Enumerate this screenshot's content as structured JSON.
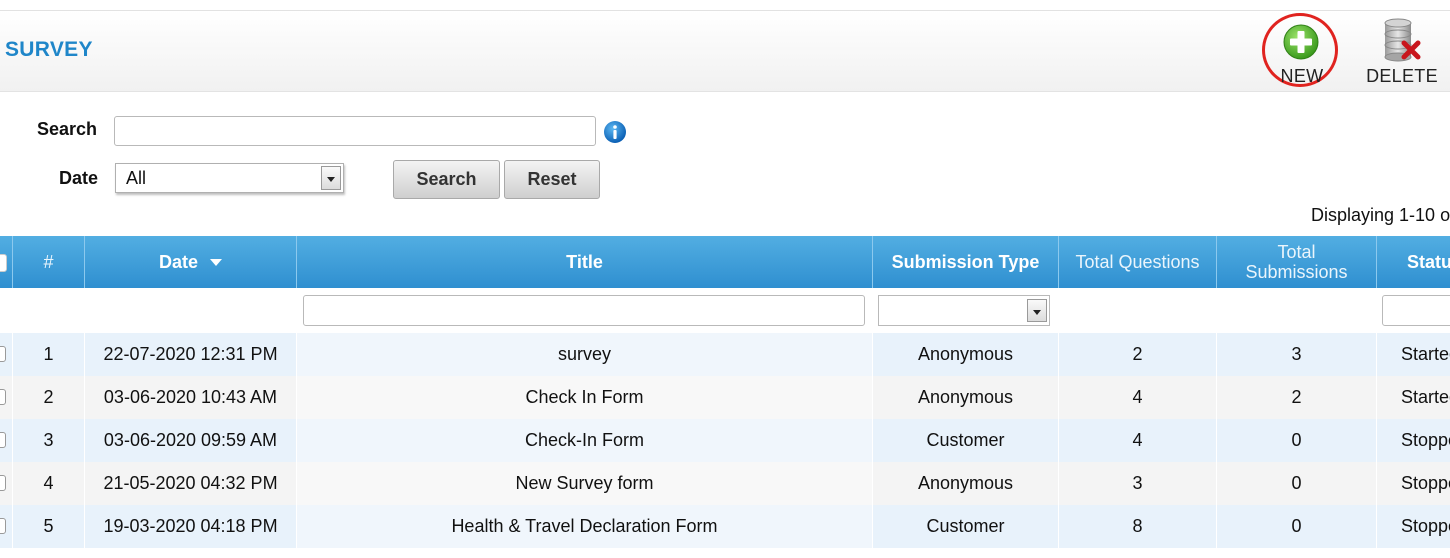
{
  "header": {
    "title": "SURVEY",
    "new_label": "NEW",
    "delete_label": "DELETE"
  },
  "filters": {
    "search_label": "Search",
    "search_value": "",
    "date_label": "Date",
    "date_selected": "All",
    "search_button": "Search",
    "reset_button": "Reset"
  },
  "paging": {
    "display_text": "Displaying 1-10 o"
  },
  "table": {
    "columns": {
      "num": "#",
      "date": "Date",
      "title": "Title",
      "submission_type": "Submission Type",
      "total_questions": "Total Questions",
      "total_submissions": "Total Submissions",
      "status": "Status"
    },
    "rows": [
      {
        "num": "1",
        "date": "22-07-2020 12:31 PM",
        "title": "survey",
        "submission_type": "Anonymous",
        "total_questions": "2",
        "total_submissions": "3",
        "status": "Started"
      },
      {
        "num": "2",
        "date": "03-06-2020 10:43 AM",
        "title": "Check In Form",
        "submission_type": "Anonymous",
        "total_questions": "4",
        "total_submissions": "2",
        "status": "Started"
      },
      {
        "num": "3",
        "date": "03-06-2020 09:59 AM",
        "title": "Check-In Form",
        "submission_type": "Customer",
        "total_questions": "4",
        "total_submissions": "0",
        "status": "Stopped"
      },
      {
        "num": "4",
        "date": "21-05-2020 04:32 PM",
        "title": "New Survey form",
        "submission_type": "Anonymous",
        "total_questions": "3",
        "total_submissions": "0",
        "status": "Stopped"
      },
      {
        "num": "5",
        "date": "19-03-2020 04:18 PM",
        "title": "Health & Travel Declaration Form",
        "submission_type": "Customer",
        "total_questions": "8",
        "total_submissions": "0",
        "status": "Stopped"
      }
    ]
  },
  "colors": {
    "accent": "#1f86c9",
    "header_blue": "#3d9bd8",
    "highlight_ring": "#e0231f",
    "new_green": "#4caf2a"
  },
  "icons": {
    "new": "plus-circle-icon",
    "delete": "database-delete-icon",
    "info": "info-icon",
    "sort": "sort-desc-icon"
  }
}
